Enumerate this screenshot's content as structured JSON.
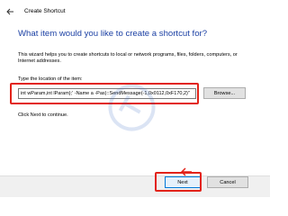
{
  "window": {
    "title": "Create Shortcut",
    "back_icon": "back-arrow-icon"
  },
  "main": {
    "heading": "What item would you like to create a shortcut for?",
    "description": "This wizard helps you to create shortcuts to local or network programs, files, folders, computers, or Internet addresses.",
    "location_label": "Type the location of the item:",
    "location_value": "int wParam,int lParam);' -Name a -Pas)::SendMessage(-1,0x0112,0xF170,2)\"",
    "browse_label": "Browse...",
    "hint": "Click Next to continue."
  },
  "footer": {
    "next_label": "Next",
    "cancel_label": "Cancel"
  },
  "annotations": {
    "highlight_color": "#e2231a",
    "watermark_text": "©TWC"
  }
}
